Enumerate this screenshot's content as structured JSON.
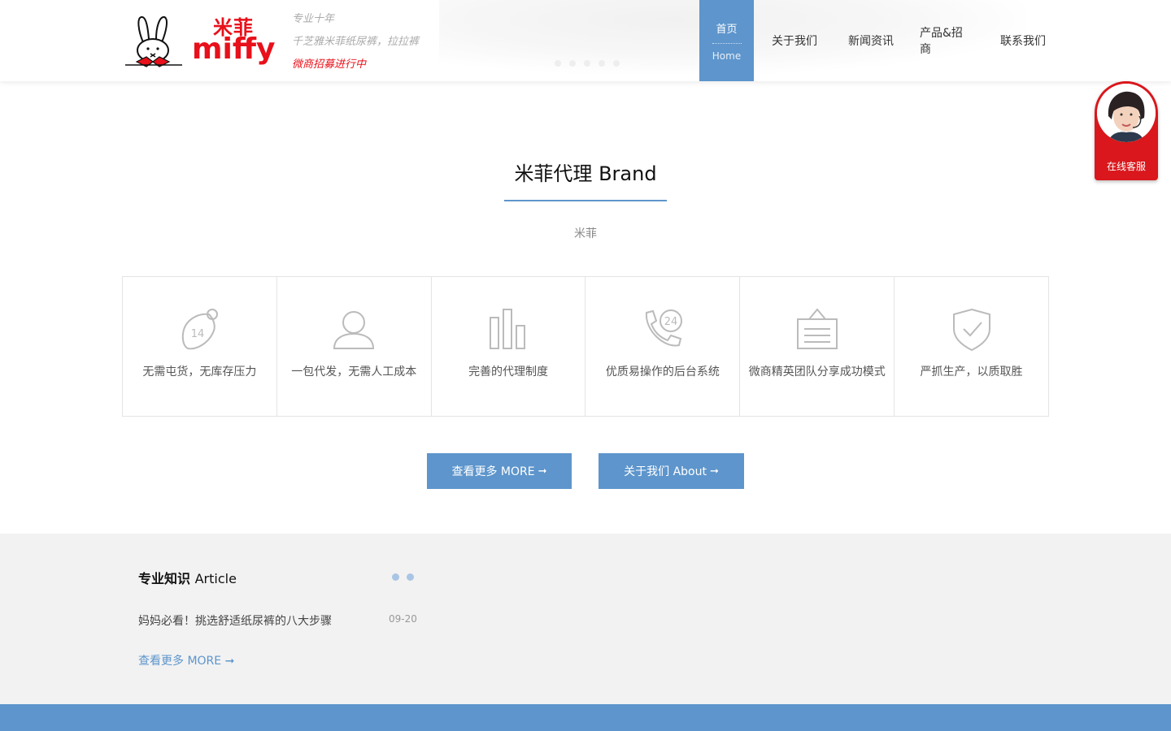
{
  "header": {
    "logo": {
      "cn": "米菲",
      "en": "miffy"
    },
    "taglines": [
      "专业十年",
      "千芝雅米菲纸尿裤，拉拉裤",
      "微商招募进行中"
    ],
    "nav": {
      "home_cn": "首页",
      "home_en": "Home",
      "items": [
        "关于我们",
        "新闻资讯",
        "产品&招商",
        "联系我们"
      ]
    }
  },
  "service": {
    "label": "在线客服"
  },
  "brand": {
    "title": "米菲代理 Brand",
    "subtitle": "米菲",
    "features": [
      {
        "icon": "radish-14-icon",
        "badge": "14",
        "text": "无需屯货，无库存压力"
      },
      {
        "icon": "user-icon",
        "text": "一包代发，无需人工成本"
      },
      {
        "icon": "bar-chart-icon",
        "text": "完善的代理制度"
      },
      {
        "icon": "phone-24-icon",
        "badge": "24",
        "text": "优质易操作的后台系统"
      },
      {
        "icon": "notice-board-icon",
        "text": "微商精英团队分享成功模式"
      },
      {
        "icon": "shield-check-icon",
        "text": "严抓生产，以质取胜"
      }
    ],
    "buttons": {
      "more": "查看更多 MORE",
      "about": "关于我们 About",
      "arrow": "➞"
    }
  },
  "article": {
    "title_cn": "专业知识",
    "title_en": "Article",
    "items": [
      {
        "title": "妈妈必看！挑选舒适纸尿裤的八大步骤",
        "date": "09-20"
      }
    ],
    "more": "查看更多 MORE"
  },
  "colors": {
    "accent": "#5d95cc",
    "brand_red": "#e8101a",
    "section_bg": "#f2f2f2"
  }
}
